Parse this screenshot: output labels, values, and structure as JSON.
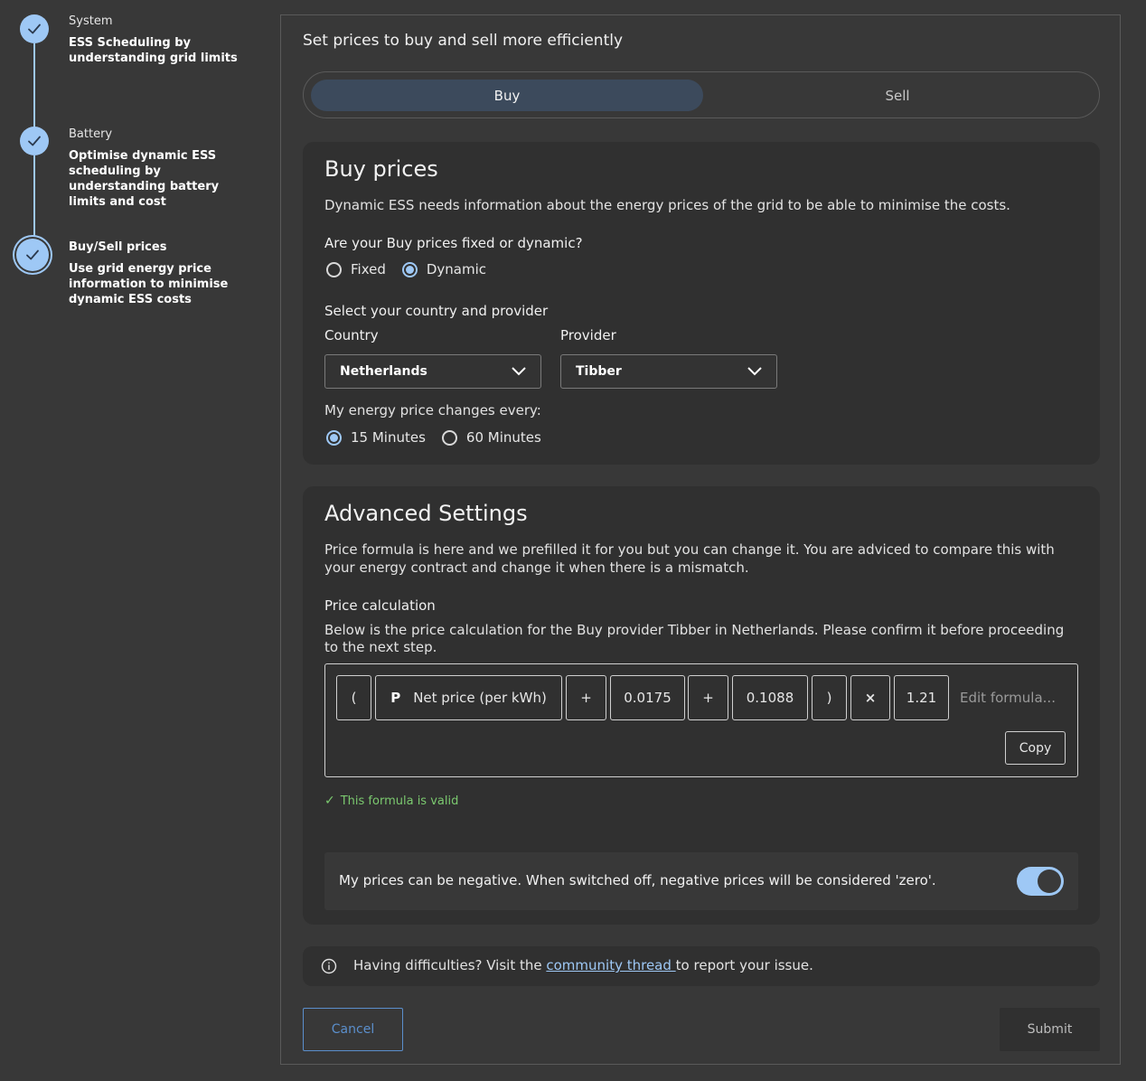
{
  "stepper": {
    "steps": [
      {
        "title": "System",
        "desc": "ESS Scheduling by understanding grid limits"
      },
      {
        "title": "Battery",
        "desc": "Optimise dynamic ESS scheduling by understanding battery limits and cost"
      },
      {
        "title": "Buy/Sell prices",
        "desc": "Use grid energy price information to minimise dynamic ESS costs"
      }
    ]
  },
  "main": {
    "title": "Set prices to buy and sell more efficiently",
    "tabs": {
      "buy": "Buy",
      "sell": "Sell"
    }
  },
  "buy_prices": {
    "heading": "Buy prices",
    "intro": "Dynamic ESS needs information about the energy prices of the grid to be able to minimise the costs.",
    "fixed_question": "Are your Buy prices fixed or dynamic?",
    "option_fixed": "Fixed",
    "option_dynamic": "Dynamic",
    "provider_heading": "Select your country and provider",
    "country_label": "Country",
    "country_value": "Netherlands",
    "provider_label": "Provider",
    "provider_value": "Tibber",
    "interval_question": "My energy price changes every:",
    "option_15": "15 Minutes",
    "option_60": "60 Minutes"
  },
  "advanced": {
    "heading": "Advanced Settings",
    "intro": "Price formula is here and we prefilled it for you but you can change it. You are adviced to compare this with your energy contract and change it when there is a mismatch.",
    "calc_heading": "Price calculation",
    "calc_desc": "Below is the price calculation for the Buy provider Tibber in Netherlands. Please confirm it before proceeding to the next step.",
    "tokens": {
      "open_paren": "(",
      "p_badge": "P",
      "net_price": "Net price (per kWh)",
      "plus1": "+",
      "val1": "0.0175",
      "plus2": "+",
      "val2": "0.1088",
      "close_paren": ")",
      "times": "×",
      "val3": "1.21"
    },
    "edit_placeholder": "Edit formula...",
    "copy_label": "Copy",
    "valid_tick": "✓",
    "valid_text": "This formula is valid",
    "negative_text": "My prices can be negative. When switched off, negative prices will be considered 'zero'."
  },
  "info": {
    "before": "Having difficulties? Visit the ",
    "link": "community thread ",
    "after": "to report your issue."
  },
  "actions": {
    "cancel": "Cancel",
    "submit": "Submit"
  },
  "colors": {
    "accent": "#9ec8f5",
    "valid": "#7bc96f",
    "link": "#5b8fcc"
  }
}
